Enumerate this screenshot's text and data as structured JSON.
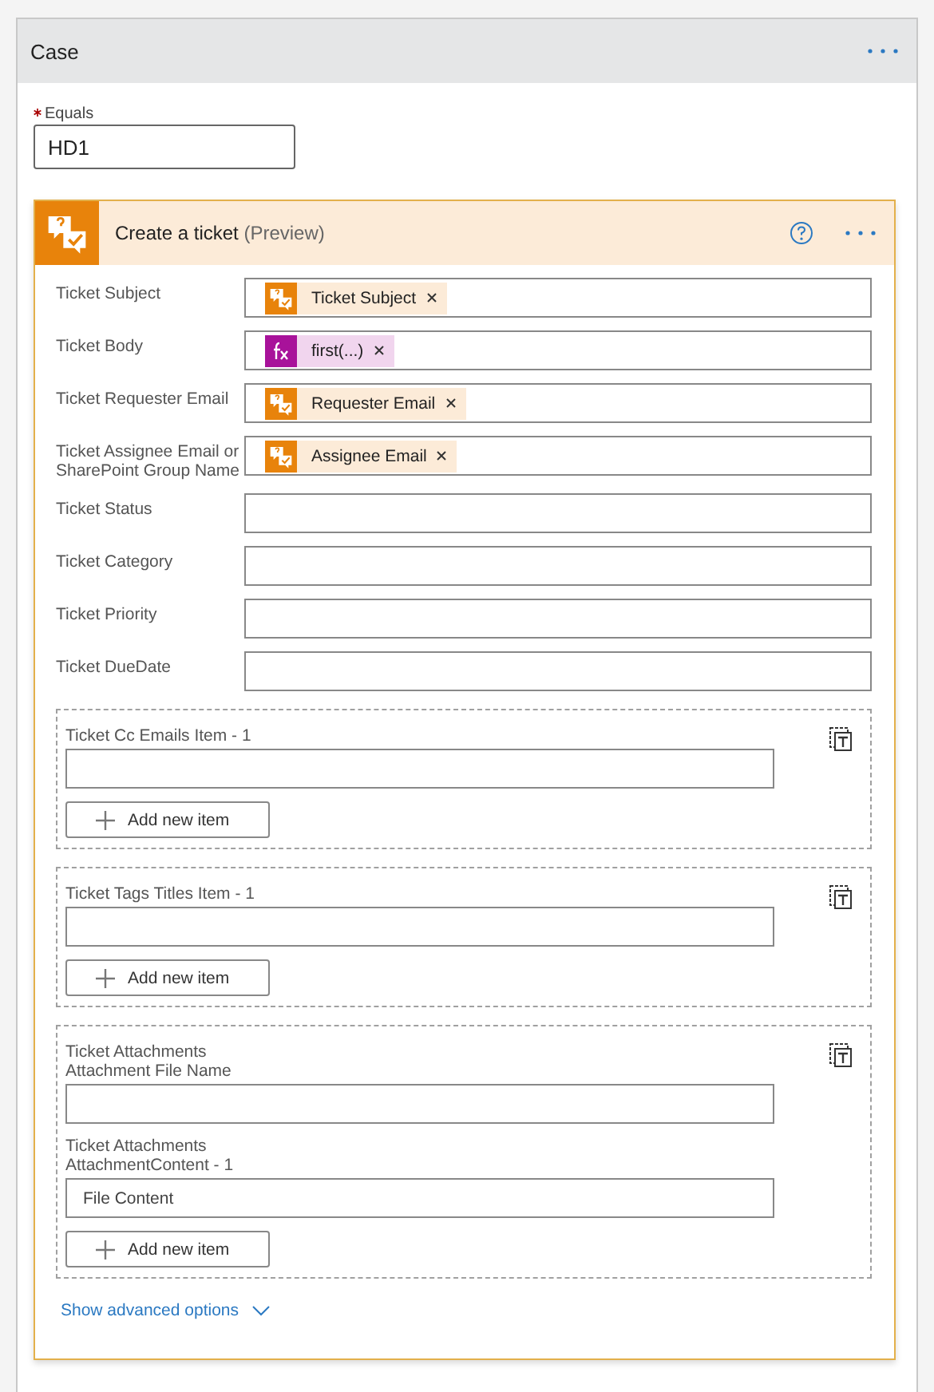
{
  "case": {
    "title": "Case"
  },
  "equals": {
    "label": "Equals",
    "required": true,
    "value": "HD1"
  },
  "action": {
    "title": "Create a ticket",
    "badge": "(Preview)",
    "fields": [
      {
        "label": "Ticket Subject",
        "token": {
          "kind": "connector",
          "label": "Ticket Subject"
        }
      },
      {
        "label": "Ticket Body",
        "token": {
          "kind": "expression",
          "label": "first(...)"
        }
      },
      {
        "label": "Ticket Requester Email",
        "token": {
          "kind": "connector",
          "label": "Requester Email"
        }
      },
      {
        "label": "Ticket Assignee Email or SharePoint Group Name",
        "token": {
          "kind": "connector",
          "label": "Assignee Email"
        }
      },
      {
        "label": "Ticket Status"
      },
      {
        "label": "Ticket Category"
      },
      {
        "label": "Ticket Priority"
      },
      {
        "label": "Ticket DueDate"
      }
    ],
    "arrays": [
      {
        "items": [
          {
            "label": "Ticket Cc Emails Item - 1"
          }
        ],
        "button": "Add new item"
      },
      {
        "items": [
          {
            "label": "Ticket Tags Titles Item - 1"
          }
        ],
        "button": "Add new item"
      },
      {
        "items": [
          {
            "label": "Ticket Attachments Attachment File Name"
          },
          {
            "label": "Ticket Attachments AttachmentContent - 1",
            "placeholder": "File Content"
          }
        ],
        "button": "Add new item"
      }
    ],
    "advanced": "Show advanced options"
  }
}
